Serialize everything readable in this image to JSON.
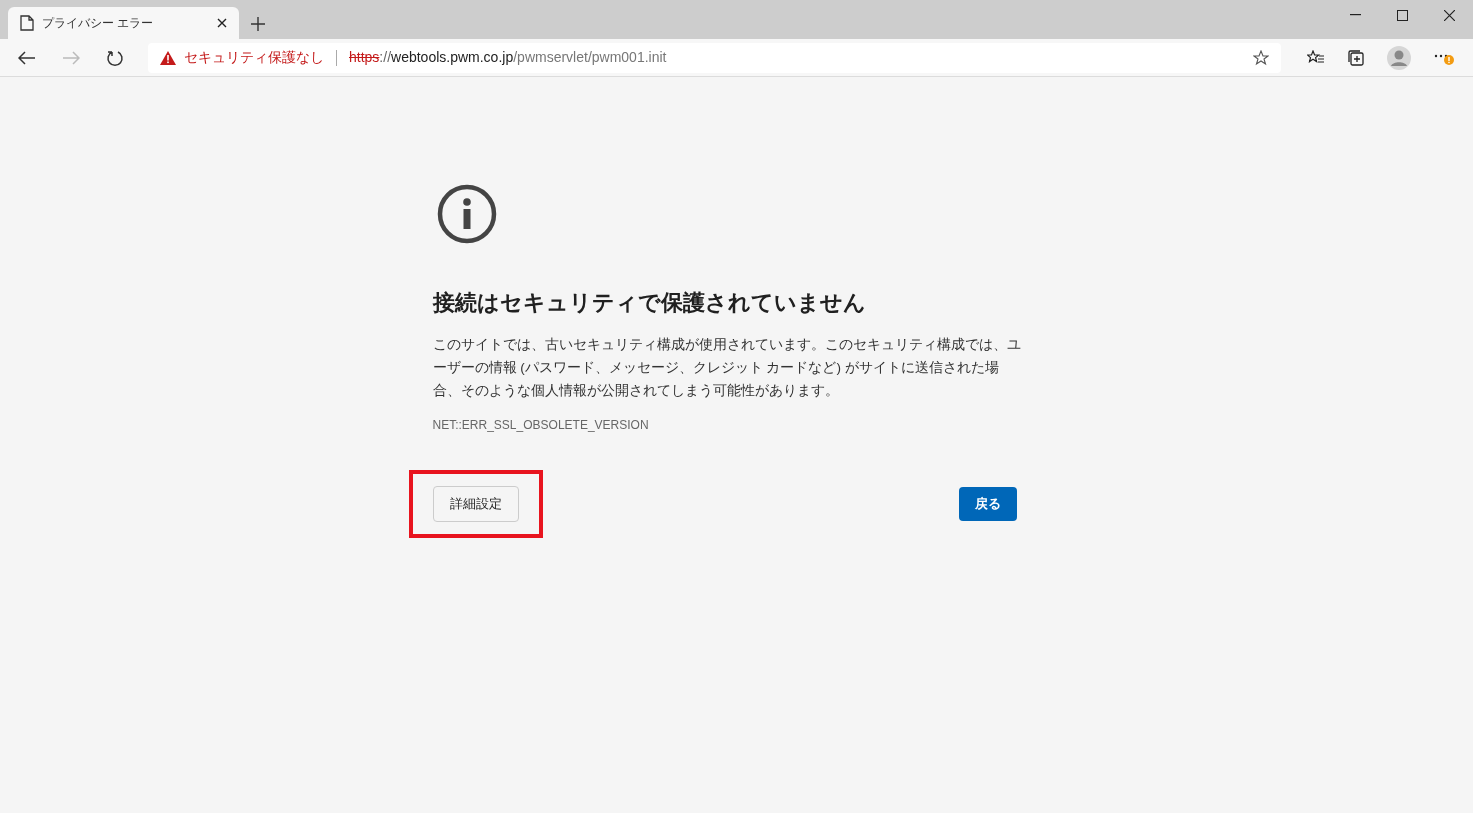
{
  "tab": {
    "title": "プライバシー エラー",
    "selected": true
  },
  "address_bar": {
    "security_label": "セキュリティ保護なし",
    "scheme": "https",
    "separator": "://",
    "host": "webtools.pwm.co.jp",
    "path": "/pwmservlet/pwm001.init"
  },
  "page": {
    "heading": "接続はセキュリティで保護されていません",
    "body": "このサイトでは、古いセキュリティ構成が使用されています。このセキュリティ構成では、ユーザーの情報 (パスワード、メッセージ、クレジット カードなど) がサイトに送信された場合、そのような個人情報が公開されてしまう可能性があります。",
    "error_code": "NET::ERR_SSL_OBSOLETE_VERSION",
    "buttons": [
      {
        "label": "詳細設定",
        "kind": "secondary",
        "highlighted": true
      },
      {
        "label": "戻る",
        "kind": "primary",
        "highlighted": false
      }
    ]
  }
}
